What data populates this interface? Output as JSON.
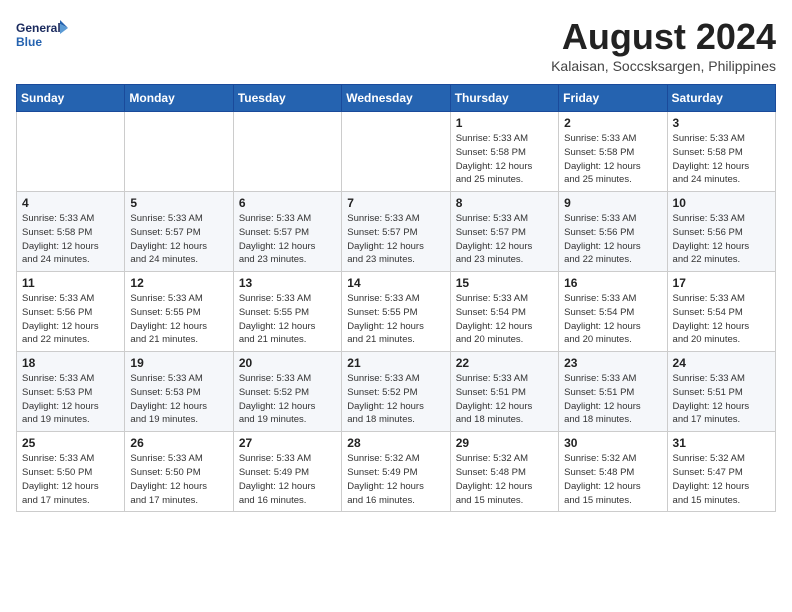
{
  "header": {
    "logo_line1": "General",
    "logo_line2": "Blue",
    "month_year": "August 2024",
    "location": "Kalaisan, Soccsksargen, Philippines"
  },
  "days_of_week": [
    "Sunday",
    "Monday",
    "Tuesday",
    "Wednesday",
    "Thursday",
    "Friday",
    "Saturday"
  ],
  "weeks": [
    [
      {
        "day": "",
        "info": ""
      },
      {
        "day": "",
        "info": ""
      },
      {
        "day": "",
        "info": ""
      },
      {
        "day": "",
        "info": ""
      },
      {
        "day": "1",
        "info": "Sunrise: 5:33 AM\nSunset: 5:58 PM\nDaylight: 12 hours\nand 25 minutes."
      },
      {
        "day": "2",
        "info": "Sunrise: 5:33 AM\nSunset: 5:58 PM\nDaylight: 12 hours\nand 25 minutes."
      },
      {
        "day": "3",
        "info": "Sunrise: 5:33 AM\nSunset: 5:58 PM\nDaylight: 12 hours\nand 24 minutes."
      }
    ],
    [
      {
        "day": "4",
        "info": "Sunrise: 5:33 AM\nSunset: 5:58 PM\nDaylight: 12 hours\nand 24 minutes."
      },
      {
        "day": "5",
        "info": "Sunrise: 5:33 AM\nSunset: 5:57 PM\nDaylight: 12 hours\nand 24 minutes."
      },
      {
        "day": "6",
        "info": "Sunrise: 5:33 AM\nSunset: 5:57 PM\nDaylight: 12 hours\nand 23 minutes."
      },
      {
        "day": "7",
        "info": "Sunrise: 5:33 AM\nSunset: 5:57 PM\nDaylight: 12 hours\nand 23 minutes."
      },
      {
        "day": "8",
        "info": "Sunrise: 5:33 AM\nSunset: 5:57 PM\nDaylight: 12 hours\nand 23 minutes."
      },
      {
        "day": "9",
        "info": "Sunrise: 5:33 AM\nSunset: 5:56 PM\nDaylight: 12 hours\nand 22 minutes."
      },
      {
        "day": "10",
        "info": "Sunrise: 5:33 AM\nSunset: 5:56 PM\nDaylight: 12 hours\nand 22 minutes."
      }
    ],
    [
      {
        "day": "11",
        "info": "Sunrise: 5:33 AM\nSunset: 5:56 PM\nDaylight: 12 hours\nand 22 minutes."
      },
      {
        "day": "12",
        "info": "Sunrise: 5:33 AM\nSunset: 5:55 PM\nDaylight: 12 hours\nand 21 minutes."
      },
      {
        "day": "13",
        "info": "Sunrise: 5:33 AM\nSunset: 5:55 PM\nDaylight: 12 hours\nand 21 minutes."
      },
      {
        "day": "14",
        "info": "Sunrise: 5:33 AM\nSunset: 5:55 PM\nDaylight: 12 hours\nand 21 minutes."
      },
      {
        "day": "15",
        "info": "Sunrise: 5:33 AM\nSunset: 5:54 PM\nDaylight: 12 hours\nand 20 minutes."
      },
      {
        "day": "16",
        "info": "Sunrise: 5:33 AM\nSunset: 5:54 PM\nDaylight: 12 hours\nand 20 minutes."
      },
      {
        "day": "17",
        "info": "Sunrise: 5:33 AM\nSunset: 5:54 PM\nDaylight: 12 hours\nand 20 minutes."
      }
    ],
    [
      {
        "day": "18",
        "info": "Sunrise: 5:33 AM\nSunset: 5:53 PM\nDaylight: 12 hours\nand 19 minutes."
      },
      {
        "day": "19",
        "info": "Sunrise: 5:33 AM\nSunset: 5:53 PM\nDaylight: 12 hours\nand 19 minutes."
      },
      {
        "day": "20",
        "info": "Sunrise: 5:33 AM\nSunset: 5:52 PM\nDaylight: 12 hours\nand 19 minutes."
      },
      {
        "day": "21",
        "info": "Sunrise: 5:33 AM\nSunset: 5:52 PM\nDaylight: 12 hours\nand 18 minutes."
      },
      {
        "day": "22",
        "info": "Sunrise: 5:33 AM\nSunset: 5:51 PM\nDaylight: 12 hours\nand 18 minutes."
      },
      {
        "day": "23",
        "info": "Sunrise: 5:33 AM\nSunset: 5:51 PM\nDaylight: 12 hours\nand 18 minutes."
      },
      {
        "day": "24",
        "info": "Sunrise: 5:33 AM\nSunset: 5:51 PM\nDaylight: 12 hours\nand 17 minutes."
      }
    ],
    [
      {
        "day": "25",
        "info": "Sunrise: 5:33 AM\nSunset: 5:50 PM\nDaylight: 12 hours\nand 17 minutes."
      },
      {
        "day": "26",
        "info": "Sunrise: 5:33 AM\nSunset: 5:50 PM\nDaylight: 12 hours\nand 17 minutes."
      },
      {
        "day": "27",
        "info": "Sunrise: 5:33 AM\nSunset: 5:49 PM\nDaylight: 12 hours\nand 16 minutes."
      },
      {
        "day": "28",
        "info": "Sunrise: 5:32 AM\nSunset: 5:49 PM\nDaylight: 12 hours\nand 16 minutes."
      },
      {
        "day": "29",
        "info": "Sunrise: 5:32 AM\nSunset: 5:48 PM\nDaylight: 12 hours\nand 15 minutes."
      },
      {
        "day": "30",
        "info": "Sunrise: 5:32 AM\nSunset: 5:48 PM\nDaylight: 12 hours\nand 15 minutes."
      },
      {
        "day": "31",
        "info": "Sunrise: 5:32 AM\nSunset: 5:47 PM\nDaylight: 12 hours\nand 15 minutes."
      }
    ]
  ]
}
